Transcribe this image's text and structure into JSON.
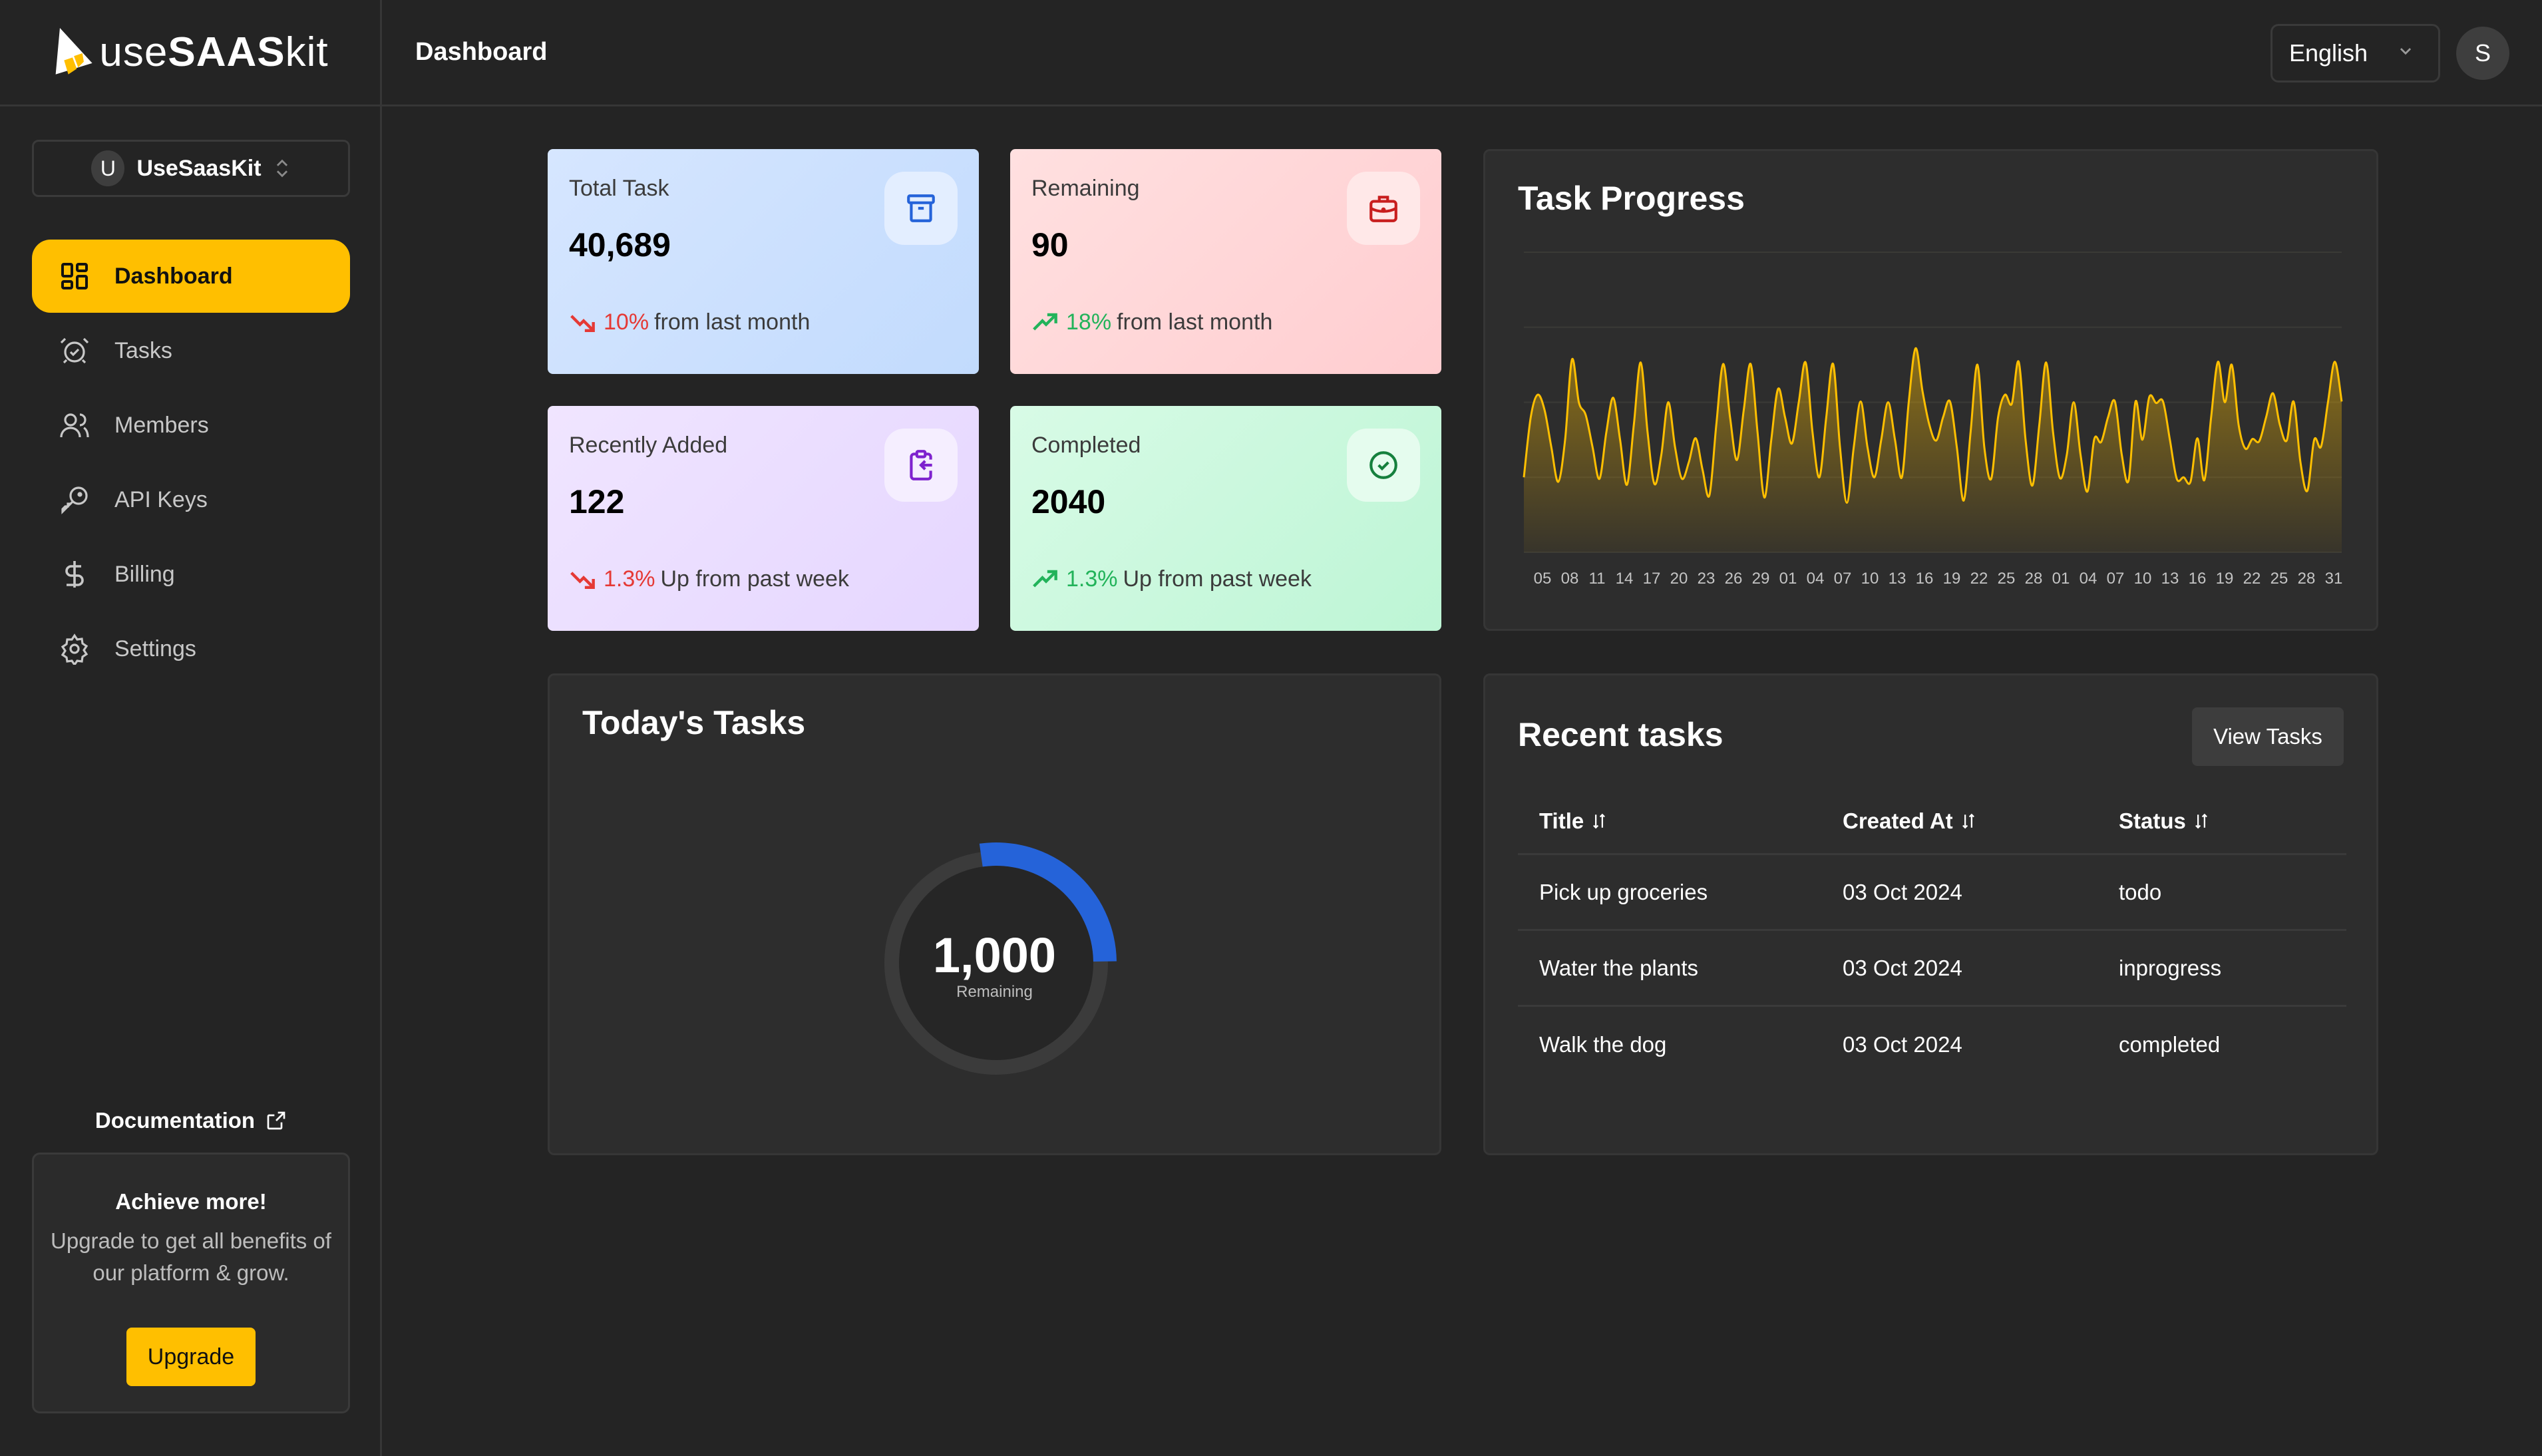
{
  "app": {
    "logo_prefix": "use",
    "logo_bold": "SAAS",
    "logo_suffix": "kit",
    "page_title": "Dashboard"
  },
  "header": {
    "language": "English",
    "user_initial": "S"
  },
  "sidebar": {
    "org": {
      "initial": "U",
      "name": "UseSaasKit"
    },
    "items": [
      {
        "label": "Dashboard",
        "icon": "dashboard-grid-icon",
        "active": true
      },
      {
        "label": "Tasks",
        "icon": "alarm-clock-check-icon",
        "active": false
      },
      {
        "label": "Members",
        "icon": "users-icon",
        "active": false
      },
      {
        "label": "API Keys",
        "icon": "key-icon",
        "active": false
      },
      {
        "label": "Billing",
        "icon": "dollar-icon",
        "active": false
      },
      {
        "label": "Settings",
        "icon": "gear-icon",
        "active": false
      }
    ],
    "documentation_label": "Documentation",
    "promo": {
      "title": "Achieve more!",
      "text": "Upgrade to get all benefits of our platform & grow.",
      "button": "Upgrade"
    }
  },
  "stats": [
    {
      "label": "Total Task",
      "value": "40,689",
      "trend": "down",
      "pct": "10%",
      "suffix": "from last month",
      "icon": "archive-box-icon"
    },
    {
      "label": "Remaining",
      "value": "90",
      "trend": "up",
      "pct": "18%",
      "suffix": "from last month",
      "icon": "briefcase-icon"
    },
    {
      "label": "Recently Added",
      "value": "122",
      "trend": "down",
      "pct": "1.3%",
      "suffix": "Up from past week",
      "icon": "clipboard-import-icon"
    },
    {
      "label": "Completed",
      "value": "2040",
      "trend": "up",
      "pct": "1.3%",
      "suffix": "Up from past week",
      "icon": "check-circle-icon"
    }
  ],
  "task_progress": {
    "title": "Task Progress"
  },
  "todays_tasks": {
    "title": "Today's Tasks",
    "value": "1,000",
    "label": "Remaining",
    "progress_fraction": 0.27,
    "bar_color": "#2563d9"
  },
  "recent_tasks": {
    "title": "Recent tasks",
    "view_button": "View Tasks",
    "columns": [
      "Title",
      "Created At",
      "Status"
    ],
    "rows": [
      {
        "title": "Pick up groceries",
        "created_at": "03 Oct 2024",
        "status": "todo"
      },
      {
        "title": "Water the plants",
        "created_at": "03 Oct 2024",
        "status": "inprogress"
      },
      {
        "title": "Walk the dog",
        "created_at": "03 Oct 2024",
        "status": "completed"
      }
    ]
  },
  "colors": {
    "accent": "#ffbf00",
    "line": "#ffbf00",
    "down": "#e53935",
    "up": "#22b35a"
  },
  "chart_data": {
    "type": "area",
    "title": "Task Progress",
    "xlabel": "",
    "ylabel": "",
    "ylim": [
      0,
      400
    ],
    "grid": true,
    "legend": "none",
    "tick_labels": [
      "05",
      "08",
      "11",
      "14",
      "17",
      "20",
      "23",
      "26",
      "29",
      "01",
      "04",
      "07",
      "10",
      "13",
      "16",
      "19",
      "22",
      "25",
      "28",
      "01",
      "04",
      "07",
      "10",
      "13",
      "16",
      "19",
      "22",
      "25",
      "28",
      "31"
    ],
    "values": [
      100,
      180,
      210,
      190,
      140,
      94,
      150,
      257,
      200,
      183,
      140,
      98,
      160,
      206,
      150,
      90,
      170,
      253,
      160,
      91,
      130,
      200,
      140,
      98,
      120,
      152,
      110,
      76,
      170,
      251,
      180,
      123,
      190,
      251,
      160,
      73,
      150,
      218,
      180,
      145,
      200,
      253,
      160,
      100,
      180,
      251,
      140,
      66,
      140,
      201,
      140,
      100,
      150,
      200,
      150,
      100,
      200,
      272,
      215,
      170,
      149,
      180,
      201,
      140,
      69,
      160,
      250,
      140,
      98,
      180,
      210,
      198,
      254,
      150,
      89,
      170,
      253,
      160,
      99,
      130,
      200,
      130,
      81,
      151,
      147,
      180,
      201,
      130,
      96,
      201,
      150,
      207,
      199,
      201,
      150,
      98,
      100,
      94,
      152,
      96,
      180,
      254,
      200,
      250,
      170,
      138,
      151,
      148,
      180,
      212,
      170,
      149,
      201,
      120,
      82,
      150,
      141,
      200,
      254,
      201
    ]
  }
}
